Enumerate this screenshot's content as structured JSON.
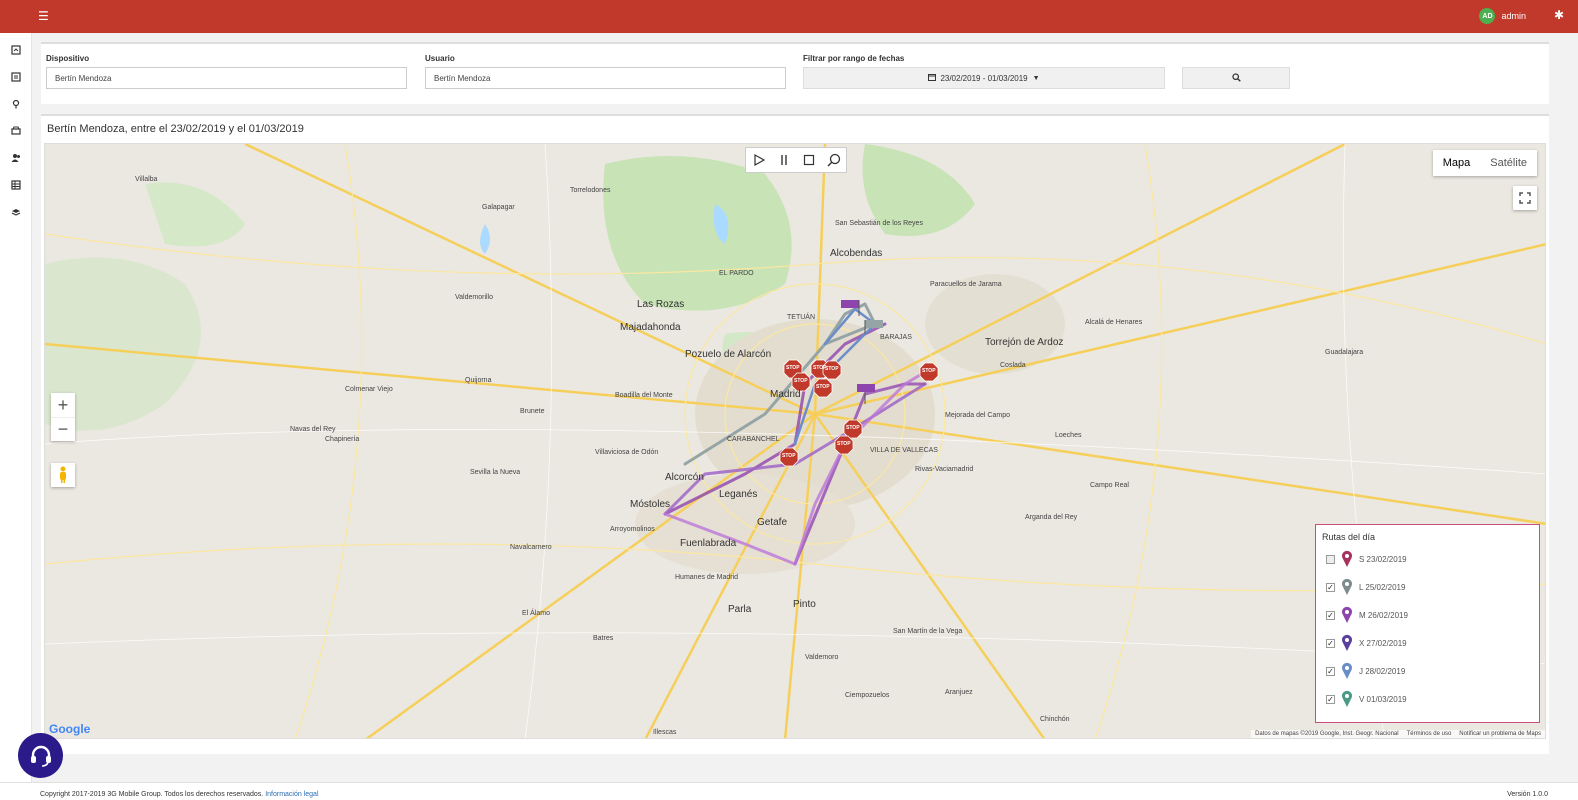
{
  "topbar": {
    "menu_icon": "hamburger-icon",
    "avatar_initials": "AD",
    "username": "admin",
    "tools_icon": "wrench-icon",
    "accent_color": "#c0392b"
  },
  "sidebar": {
    "items": [
      {
        "icon": "dashboard-icon"
      },
      {
        "icon": "report-icon"
      },
      {
        "icon": "map-pin-icon"
      },
      {
        "icon": "vehicle-icon"
      },
      {
        "icon": "users-icon"
      },
      {
        "icon": "table-icon"
      },
      {
        "icon": "layers-icon"
      }
    ]
  },
  "filters": {
    "device_label": "Dispositivo",
    "device_value": "Bertín Mendoza",
    "user_label": "Usuario",
    "user_value": "Bertín Mendoza",
    "date_label": "Filtrar por rango de fechas",
    "date_value": "23/02/2019 - 01/03/2019",
    "search_icon": "search-icon"
  },
  "panel": {
    "title": "Bertín Mendoza, entre el 23/02/2019 y el 01/03/2019"
  },
  "map": {
    "type_options": [
      "Mapa",
      "Satélite"
    ],
    "selected_type": "Mapa",
    "google_logo": "Google",
    "attribution": "Datos de mapas ©2019 Google, Inst. Geogr. Nacional",
    "terms": "Términos de uso",
    "report": "Notificar un problema de Maps",
    "playback_controls": [
      "play-icon",
      "pause-icon",
      "stop-icon",
      "search-icon"
    ],
    "places": {
      "madrid": "Madrid",
      "alcobendas": "Alcobendas",
      "pozuelo": "Pozuelo de Alarcón",
      "majadahonda": "Majadahonda",
      "las_rozas": "Las Rozas",
      "alcorcon": "Alcorcón",
      "leganes": "Leganés",
      "getafe": "Getafe",
      "mostoles": "Móstoles",
      "fuenlabrada": "Fuenlabrada",
      "torrejon": "Torrejón de Ardoz",
      "san_sebastian": "San Sebastián de los Reyes",
      "rivas": "Rivas-Vaciamadrid",
      "villaviciosa": "Villaviciosa de Odón",
      "boadilla": "Boadilla del Monte",
      "parla": "Parla",
      "pinto": "Pinto",
      "valdemoro": "Valdemoro",
      "alcala": "Alcalá de Henares",
      "arganda": "Arganda del Rey",
      "navalcarnero": "Navalcarnero",
      "colmenar": "Colmenar Viejo",
      "villalba": "Villalba",
      "galapagar": "Galapagar",
      "torrelodones": "Torrelodones",
      "coslada": "Coslada",
      "mejorada": "Mejorada del Campo",
      "ciempozuelos": "Ciempozuelos",
      "aranjuez": "Aranjuez",
      "guadalajara": "Guadalajara",
      "chinchon": "Chinchón",
      "illescas": "Illescas",
      "humanes": "Humanes de Madrid",
      "brunete": "Brunete",
      "el_alamo": "El Álamo",
      "batres": "Batres",
      "arroyomolinos": "Arroyomolinos",
      "paracuellos": "Paracuellos de Jarama",
      "carabanchel": "CARABANCHEL",
      "vallecas": "VILLA DE VALLECAS",
      "tetuan": "TETUÁN",
      "barajas": "BARAJAS",
      "el_pardo": "EL PARDO",
      "sevilla_nueva": "Sevilla la Nueva",
      "valdemorillo": "Valdemorillo",
      "quijorna": "Quijorna",
      "chapineria": "Chapinería",
      "navas_del_rey": "Navas del Rey",
      "san_martin": "San Martín de la Vega",
      "loeches": "Loeches",
      "campo_real": "Campo Real"
    }
  },
  "legend": {
    "title": "Rutas del día",
    "routes": [
      {
        "label": "S 23/02/2019",
        "checked": false,
        "color": "#a8325e"
      },
      {
        "label": "L 25/02/2019",
        "checked": true,
        "color": "#7f8c8d"
      },
      {
        "label": "M 26/02/2019",
        "checked": true,
        "color": "#8e44ad"
      },
      {
        "label": "X 27/02/2019",
        "checked": true,
        "color": "#5b3f9e"
      },
      {
        "label": "J 28/02/2019",
        "checked": true,
        "color": "#6b8ec9"
      },
      {
        "label": "V 01/03/2019",
        "checked": true,
        "color": "#4a9a86"
      }
    ]
  },
  "stop_label": "STOP",
  "chat_icon": "headset-icon",
  "footer": {
    "copyright": "Copyright 2017-2019 3G Mobile Group. Todos los derechos reservados.",
    "legal_link": "Información legal",
    "version": "Versión 1.0.0"
  }
}
